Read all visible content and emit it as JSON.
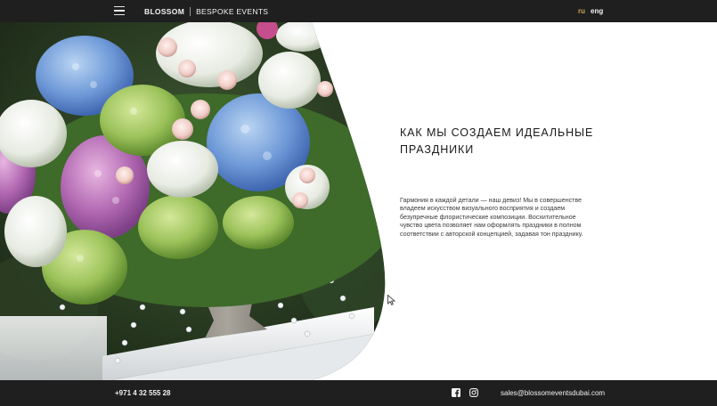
{
  "header": {
    "brand_primary": "BLOSSOM",
    "brand_secondary": "BESPOKE EVENTS",
    "lang_ru": "ru",
    "lang_en": "eng"
  },
  "main": {
    "heading_line1": "КАК МЫ СОЗДАЕМ ИДЕАЛЬНЫЕ",
    "heading_line2": "ПРАЗДНИКИ",
    "body_lines": [
      "Гармония в каждой детали — наш девиз! Мы в совершенстве",
      "владеем искусством визуального восприятия и создаем",
      "безупречные флористические композиции. Восхитительное",
      "чувство цвета позволяет нам оформлять праздники в полном",
      "соответствии с авторской концепцией, задавая тон празднику."
    ]
  },
  "footer": {
    "phone": "+971 4 32 555 28",
    "email": "sales@blossomeventsdubai.com"
  },
  "colors": {
    "bar_background": "#1f1f1f",
    "active_language": "#c9a54a",
    "page_background": "#ffffff"
  },
  "icons": [
    "menu-icon",
    "facebook-icon",
    "instagram-icon",
    "mouse-cursor-icon"
  ]
}
